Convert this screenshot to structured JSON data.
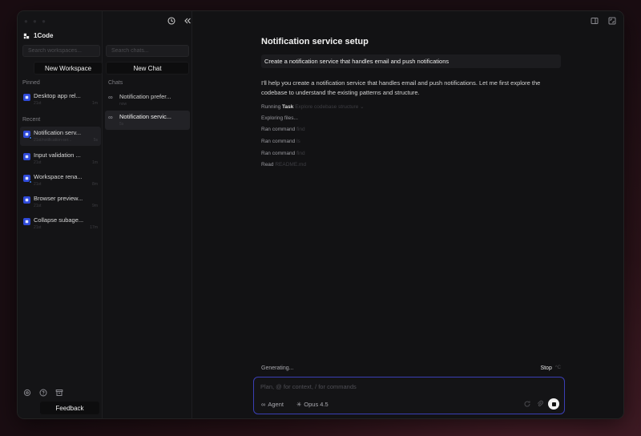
{
  "app": {
    "brand": "1Code",
    "traffic_lights": "● ● ●"
  },
  "sidebar": {
    "search_placeholder": "Search workspaces...",
    "new_workspace_label": "New Workspace",
    "pinned_label": "Pinned",
    "pinned": [
      {
        "title": "Desktop app rel...",
        "meta_left": "21st",
        "meta_right": "1m"
      }
    ],
    "recent_label": "Recent",
    "recent": [
      {
        "title": "Notification serv...",
        "meta_left": "21st/notification-ser...",
        "meta_right": "5s",
        "active": true
      },
      {
        "title": "Input validation ...",
        "meta_left": "21st",
        "meta_right": "1m"
      },
      {
        "title": "Workspace rena...",
        "meta_left": "21st",
        "meta_right": "8m"
      },
      {
        "title": "Browser preview...",
        "meta_left": "21st",
        "meta_right": "9m"
      },
      {
        "title": "Collapse subage...",
        "meta_left": "21st",
        "meta_right": "17m"
      }
    ],
    "feedback_label": "Feedback"
  },
  "chats": {
    "search_placeholder": "Search chats...",
    "new_chat_label": "New Chat",
    "section_label": "Chats",
    "items": [
      {
        "title": "Notification prefer...",
        "meta": "now"
      },
      {
        "title": "Notification servic...",
        "meta": "5s",
        "active": true
      }
    ]
  },
  "main": {
    "title": "Notification service setup",
    "user_message": "Create a notification service that handles email and push notifications",
    "assistant_message": "I'll help you create a notification service that handles email and push notifications. Let me first explore the codebase to understand the existing patterns and structure.",
    "tools": [
      {
        "prefix": "Running",
        "name": "Task",
        "detail": "Explore codebase structure",
        "chev": "⌄"
      },
      {
        "sub": "Exploring files..."
      },
      {
        "prefix": "Ran command",
        "detail": "find"
      },
      {
        "prefix": "Ran command",
        "detail": "ls"
      },
      {
        "prefix": "Ran command",
        "detail": "find"
      },
      {
        "prefix": "Read",
        "detail": "README.md"
      }
    ],
    "generating_label": "Generating...",
    "stop_label": "Stop",
    "stop_kbd": "^C",
    "composer_placeholder": "Plan, @ for context, / for commands",
    "mode_label": "Agent",
    "model_label": "Opus 4.5"
  },
  "icons": {
    "history": "clock-icon",
    "collapse": "double-chevron-left-icon",
    "settings": "gear-icon",
    "help": "help-circle-icon",
    "archive": "archive-icon"
  },
  "colors": {
    "accent": "#3b3fb5",
    "workspace_icon": "#2f4ad9"
  }
}
